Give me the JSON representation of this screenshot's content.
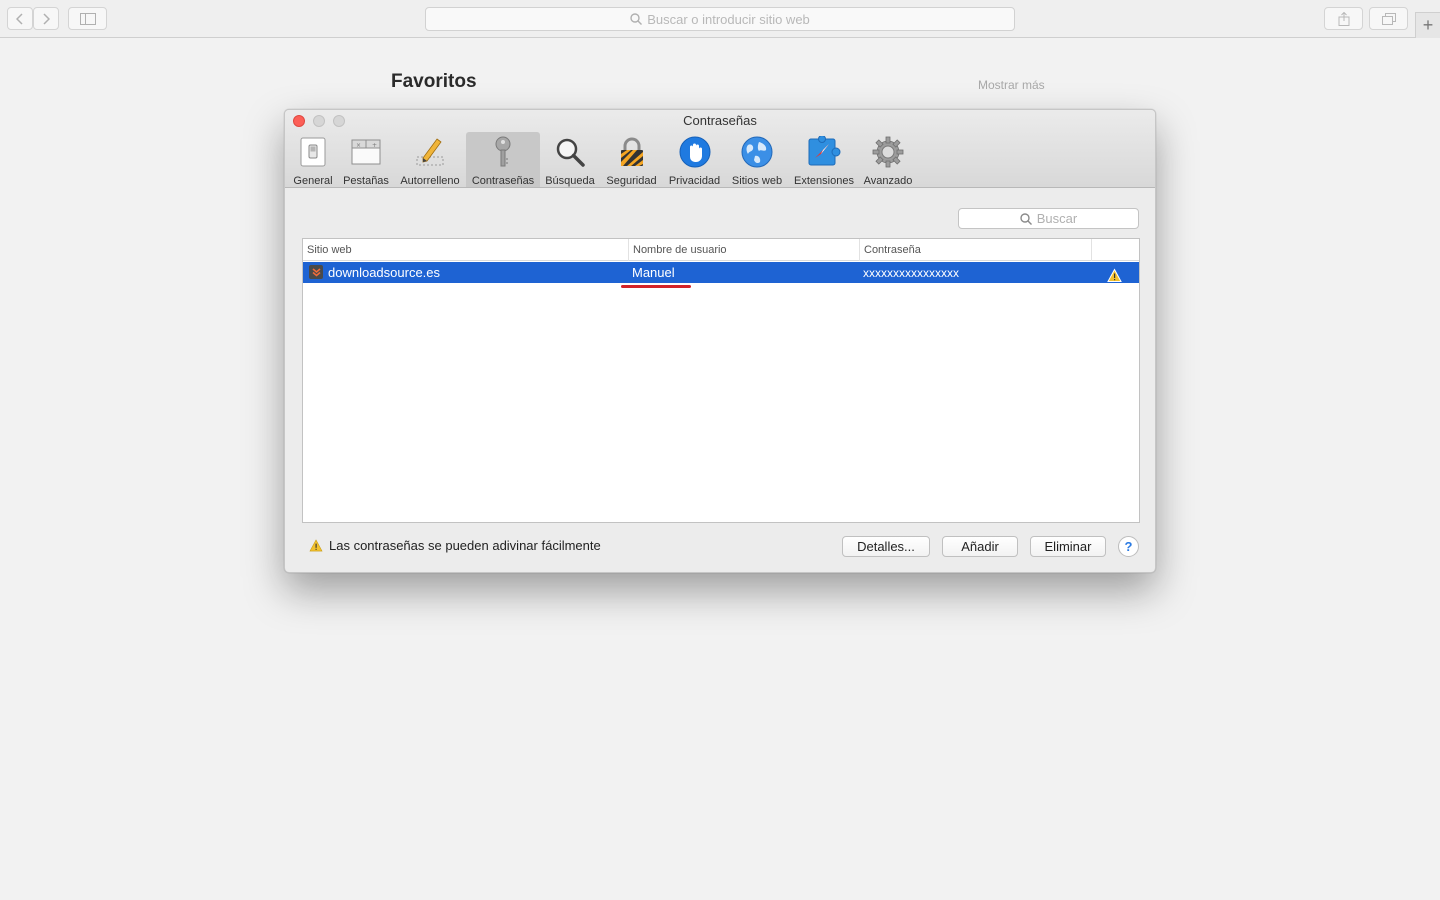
{
  "browser": {
    "address_placeholder": "Buscar o introducir sitio web",
    "new_tab_label": "+"
  },
  "page": {
    "favorites_title": "Favoritos",
    "show_more": "Mostrar más"
  },
  "prefs": {
    "window_title": "Contraseñas",
    "tabs": [
      {
        "label": "General",
        "icon": "switch-icon"
      },
      {
        "label": "Pestañas",
        "icon": "tabs-icon"
      },
      {
        "label": "Autorrelleno",
        "icon": "pencil-icon"
      },
      {
        "label": "Contraseñas",
        "icon": "key-icon",
        "active": true
      },
      {
        "label": "Búsqueda",
        "icon": "magnifier-icon"
      },
      {
        "label": "Seguridad",
        "icon": "padlock-icon"
      },
      {
        "label": "Privacidad",
        "icon": "hand-icon"
      },
      {
        "label": "Sitios web",
        "icon": "globe-icon"
      },
      {
        "label": "Extensiones",
        "icon": "puzzle-compass-icon"
      },
      {
        "label": "Avanzado",
        "icon": "gear-icon"
      }
    ],
    "search_placeholder": "Buscar",
    "columns": [
      "Sitio web",
      "Nombre de usuario",
      "Contraseña"
    ],
    "rows": [
      {
        "site": "downloadsource.es",
        "username": "Manuel",
        "password": "xxxxxxxxxxxxxxxx",
        "weak": true
      }
    ],
    "warning_text": "Las contraseñas se pueden adivinar fácilmente",
    "buttons": {
      "details": "Detalles...",
      "add": "Añadir",
      "remove": "Eliminar",
      "help": "?"
    },
    "colors": {
      "selection": "#1e63d3",
      "warning": "#f2c12e",
      "close_button": "#fc5f57"
    }
  }
}
